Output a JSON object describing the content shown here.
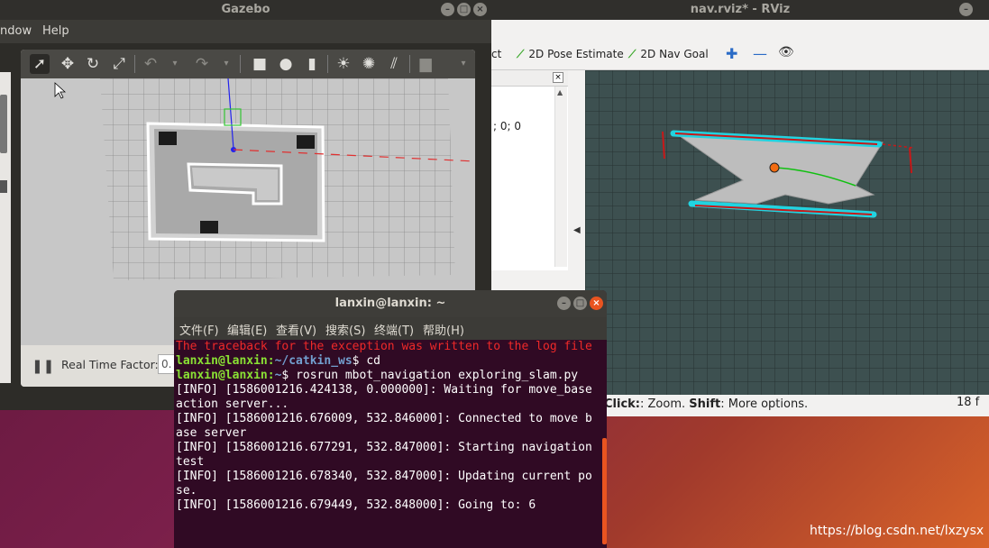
{
  "gazebo": {
    "title": "Gazebo",
    "menu": [
      "ndow",
      "Help"
    ],
    "bottom": {
      "rtf_label": "Real Time Factor:",
      "rtf_value": "0."
    }
  },
  "rviz": {
    "title": "nav.rviz* - RViz",
    "toolbar": {
      "partial": "ct",
      "pose_estimate": "2D Pose Estimate",
      "nav_goal": "2D Nav Goal"
    },
    "left_text": "; 0; 0",
    "status": {
      "click": "Click:",
      "zoom": ": Zoom. ",
      "shift": "Shift",
      "more": ": More options.",
      "fps": "18 f"
    }
  },
  "terminal": {
    "title": "lanxin@lanxin: ~",
    "menu": [
      "文件(F)",
      "编辑(E)",
      "查看(V)",
      "搜索(S)",
      "终端(T)",
      "帮助(H)"
    ],
    "error_line": "The traceback for the exception was written to the log file",
    "prompt_user": "lanxin@lanxin",
    "path1": "~/catkin_ws",
    "cmd1": "cd",
    "path2": "~",
    "cmd2": "rosrun mbot_navigation exploring_slam.py",
    "log": [
      "[INFO] [1586001216.424138, 0.000000]: Waiting for move_base action server...",
      "[INFO] [1586001216.676009, 532.846000]: Connected to move base server",
      "[INFO] [1586001216.677291, 532.847000]: Starting navigation test",
      "[INFO] [1586001216.678340, 532.847000]: Updating current pose.",
      "[INFO] [1586001216.679449, 532.848000]: Going to: 6"
    ]
  },
  "watermark": "https://blog.csdn.net/lxzysx",
  "colors": {
    "accent": "#e95420",
    "terminal_bg": "#300a24",
    "rviz_bg": "#3d5050"
  }
}
